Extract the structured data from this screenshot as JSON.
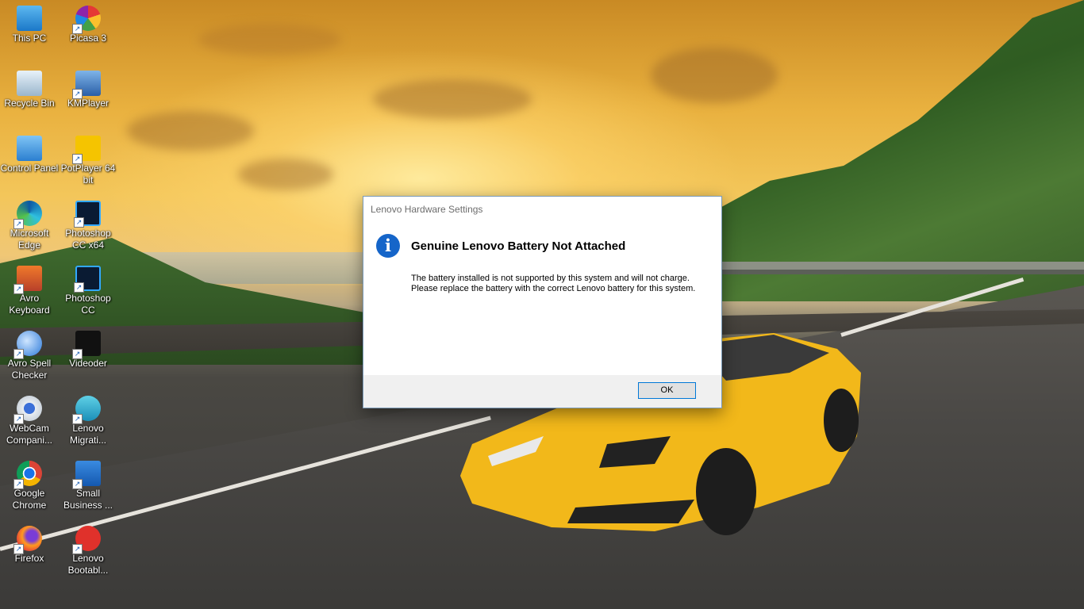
{
  "desktop": {
    "icons": [
      {
        "label": "This PC",
        "icon": "this-pc-icon"
      },
      {
        "label": "Picasa 3",
        "icon": "picasa-icon"
      },
      {
        "label": "Recycle Bin",
        "icon": "recycle-bin-icon"
      },
      {
        "label": "KMPlayer",
        "icon": "kmplayer-icon"
      },
      {
        "label": "Control Panel",
        "icon": "control-panel-icon"
      },
      {
        "label": "PotPlayer 64 bit",
        "icon": "potplayer-icon"
      },
      {
        "label": "Microsoft Edge",
        "icon": "edge-icon"
      },
      {
        "label": "Photoshop CC x64",
        "icon": "photoshop-x64-icon"
      },
      {
        "label": "Avro Keyboard",
        "icon": "avro-keyboard-icon"
      },
      {
        "label": "Photoshop CC",
        "icon": "photoshop-icon"
      },
      {
        "label": "Avro Spell Checker",
        "icon": "avro-spell-checker-icon"
      },
      {
        "label": "Videoder",
        "icon": "videoder-icon"
      },
      {
        "label": "WebCam Compani...",
        "icon": "webcam-icon"
      },
      {
        "label": "Lenovo Migrati...",
        "icon": "lenovo-migration-icon"
      },
      {
        "label": "Google Chrome",
        "icon": "chrome-icon"
      },
      {
        "label": "Small Business ...",
        "icon": "small-business-icon"
      },
      {
        "label": "Firefox",
        "icon": "firefox-icon"
      },
      {
        "label": "Lenovo Bootabl...",
        "icon": "lenovo-bootable-icon"
      }
    ]
  },
  "dialog": {
    "title": "Lenovo Hardware Settings",
    "icon": "info-icon",
    "heading": "Genuine Lenovo Battery Not Attached",
    "message": "The battery installed is not supported by this system and will not charge. Please replace the battery with the correct Lenovo battery for this system.",
    "ok_label": "OK"
  },
  "colors": {
    "accent": "#0078d7",
    "info_icon": "#1565c9",
    "car": "#f2b81a"
  }
}
